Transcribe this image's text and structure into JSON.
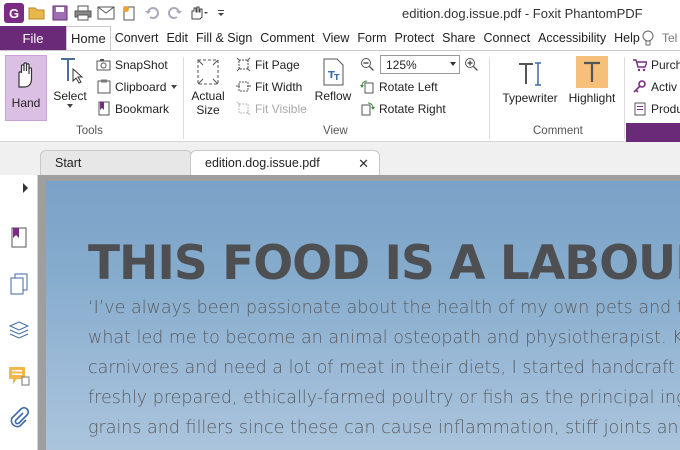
{
  "window": {
    "title": "edition.dog.issue.pdf - Foxit PhantomPDF",
    "app_logo": "G"
  },
  "menu": {
    "file": "File",
    "tabs": [
      "Home",
      "Convert",
      "Edit",
      "Fill & Sign",
      "Comment",
      "View",
      "Form",
      "Protect",
      "Share",
      "Connect",
      "Accessibility",
      "Help"
    ],
    "active_tab": "Home",
    "tell_me": "Tel"
  },
  "ribbon": {
    "tools": {
      "label": "Tools",
      "hand": "Hand",
      "select": "Select",
      "snapshot": "SnapShot",
      "clipboard": "Clipboard",
      "bookmark": "Bookmark"
    },
    "view": {
      "label": "View",
      "actual_size_1": "Actual",
      "actual_size_2": "Size",
      "fit_page": "Fit Page",
      "fit_width": "Fit Width",
      "fit_visible": "Fit Visible",
      "reflow": "Reflow",
      "zoom_value": "125%",
      "rotate_left": "Rotate Left",
      "rotate_right": "Rotate Right"
    },
    "comment": {
      "label": "Comment",
      "typewriter": "Typewriter",
      "highlight": "Highlight"
    },
    "extra": {
      "purchase": "Purch",
      "activate": "Activ",
      "product": "Produ"
    }
  },
  "doc_tabs": {
    "start": "Start",
    "current": "edition.dog.issue.pdf"
  },
  "page": {
    "headline": "THIS FOOD IS A LABOUR O",
    "lines": [
      "‘I’ve always been passionate about the health of my own pets and that",
      "what led me to become an animal osteopath and physiotherapist. Know",
      "carnivores and need a lot of meat in their diets, I started handcraft",
      "freshly prepared, ethically-farmed poultry or fish as the principal ing",
      "grains and fillers since these can cause inflammation, stiff joints and di"
    ]
  },
  "colors": {
    "brand_purple": "#6b2a78",
    "hand_active_bg": "#dcc0e4",
    "page_blue": "#86accd"
  }
}
